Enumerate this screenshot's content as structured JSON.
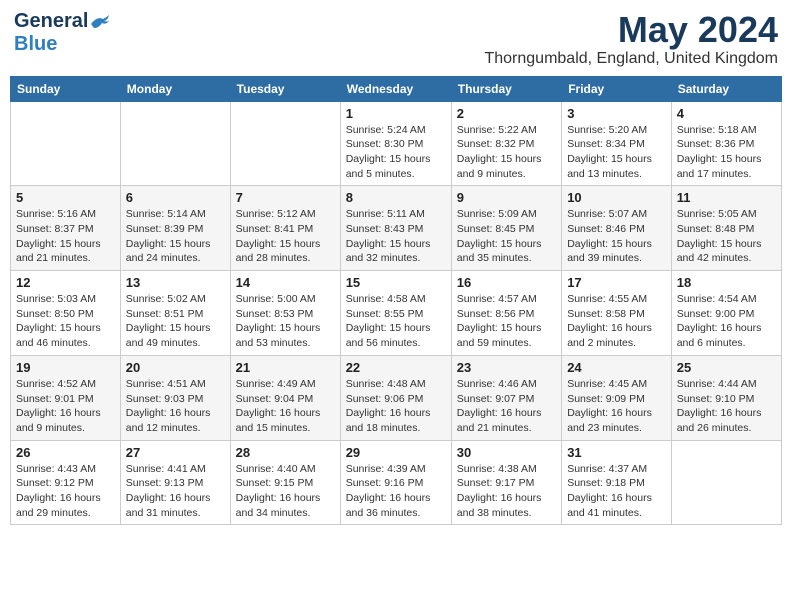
{
  "logo": {
    "general": "General",
    "blue": "Blue"
  },
  "title": {
    "month_year": "May 2024",
    "location": "Thorngumbald, England, United Kingdom"
  },
  "weekdays": [
    "Sunday",
    "Monday",
    "Tuesday",
    "Wednesday",
    "Thursday",
    "Friday",
    "Saturday"
  ],
  "weeks": [
    [
      {
        "day": "",
        "info": ""
      },
      {
        "day": "",
        "info": ""
      },
      {
        "day": "",
        "info": ""
      },
      {
        "day": "1",
        "info": "Sunrise: 5:24 AM\nSunset: 8:30 PM\nDaylight: 15 hours\nand 5 minutes."
      },
      {
        "day": "2",
        "info": "Sunrise: 5:22 AM\nSunset: 8:32 PM\nDaylight: 15 hours\nand 9 minutes."
      },
      {
        "day": "3",
        "info": "Sunrise: 5:20 AM\nSunset: 8:34 PM\nDaylight: 15 hours\nand 13 minutes."
      },
      {
        "day": "4",
        "info": "Sunrise: 5:18 AM\nSunset: 8:36 PM\nDaylight: 15 hours\nand 17 minutes."
      }
    ],
    [
      {
        "day": "5",
        "info": "Sunrise: 5:16 AM\nSunset: 8:37 PM\nDaylight: 15 hours\nand 21 minutes."
      },
      {
        "day": "6",
        "info": "Sunrise: 5:14 AM\nSunset: 8:39 PM\nDaylight: 15 hours\nand 24 minutes."
      },
      {
        "day": "7",
        "info": "Sunrise: 5:12 AM\nSunset: 8:41 PM\nDaylight: 15 hours\nand 28 minutes."
      },
      {
        "day": "8",
        "info": "Sunrise: 5:11 AM\nSunset: 8:43 PM\nDaylight: 15 hours\nand 32 minutes."
      },
      {
        "day": "9",
        "info": "Sunrise: 5:09 AM\nSunset: 8:45 PM\nDaylight: 15 hours\nand 35 minutes."
      },
      {
        "day": "10",
        "info": "Sunrise: 5:07 AM\nSunset: 8:46 PM\nDaylight: 15 hours\nand 39 minutes."
      },
      {
        "day": "11",
        "info": "Sunrise: 5:05 AM\nSunset: 8:48 PM\nDaylight: 15 hours\nand 42 minutes."
      }
    ],
    [
      {
        "day": "12",
        "info": "Sunrise: 5:03 AM\nSunset: 8:50 PM\nDaylight: 15 hours\nand 46 minutes."
      },
      {
        "day": "13",
        "info": "Sunrise: 5:02 AM\nSunset: 8:51 PM\nDaylight: 15 hours\nand 49 minutes."
      },
      {
        "day": "14",
        "info": "Sunrise: 5:00 AM\nSunset: 8:53 PM\nDaylight: 15 hours\nand 53 minutes."
      },
      {
        "day": "15",
        "info": "Sunrise: 4:58 AM\nSunset: 8:55 PM\nDaylight: 15 hours\nand 56 minutes."
      },
      {
        "day": "16",
        "info": "Sunrise: 4:57 AM\nSunset: 8:56 PM\nDaylight: 15 hours\nand 59 minutes."
      },
      {
        "day": "17",
        "info": "Sunrise: 4:55 AM\nSunset: 8:58 PM\nDaylight: 16 hours\nand 2 minutes."
      },
      {
        "day": "18",
        "info": "Sunrise: 4:54 AM\nSunset: 9:00 PM\nDaylight: 16 hours\nand 6 minutes."
      }
    ],
    [
      {
        "day": "19",
        "info": "Sunrise: 4:52 AM\nSunset: 9:01 PM\nDaylight: 16 hours\nand 9 minutes."
      },
      {
        "day": "20",
        "info": "Sunrise: 4:51 AM\nSunset: 9:03 PM\nDaylight: 16 hours\nand 12 minutes."
      },
      {
        "day": "21",
        "info": "Sunrise: 4:49 AM\nSunset: 9:04 PM\nDaylight: 16 hours\nand 15 minutes."
      },
      {
        "day": "22",
        "info": "Sunrise: 4:48 AM\nSunset: 9:06 PM\nDaylight: 16 hours\nand 18 minutes."
      },
      {
        "day": "23",
        "info": "Sunrise: 4:46 AM\nSunset: 9:07 PM\nDaylight: 16 hours\nand 21 minutes."
      },
      {
        "day": "24",
        "info": "Sunrise: 4:45 AM\nSunset: 9:09 PM\nDaylight: 16 hours\nand 23 minutes."
      },
      {
        "day": "25",
        "info": "Sunrise: 4:44 AM\nSunset: 9:10 PM\nDaylight: 16 hours\nand 26 minutes."
      }
    ],
    [
      {
        "day": "26",
        "info": "Sunrise: 4:43 AM\nSunset: 9:12 PM\nDaylight: 16 hours\nand 29 minutes."
      },
      {
        "day": "27",
        "info": "Sunrise: 4:41 AM\nSunset: 9:13 PM\nDaylight: 16 hours\nand 31 minutes."
      },
      {
        "day": "28",
        "info": "Sunrise: 4:40 AM\nSunset: 9:15 PM\nDaylight: 16 hours\nand 34 minutes."
      },
      {
        "day": "29",
        "info": "Sunrise: 4:39 AM\nSunset: 9:16 PM\nDaylight: 16 hours\nand 36 minutes."
      },
      {
        "day": "30",
        "info": "Sunrise: 4:38 AM\nSunset: 9:17 PM\nDaylight: 16 hours\nand 38 minutes."
      },
      {
        "day": "31",
        "info": "Sunrise: 4:37 AM\nSunset: 9:18 PM\nDaylight: 16 hours\nand 41 minutes."
      },
      {
        "day": "",
        "info": ""
      }
    ]
  ]
}
